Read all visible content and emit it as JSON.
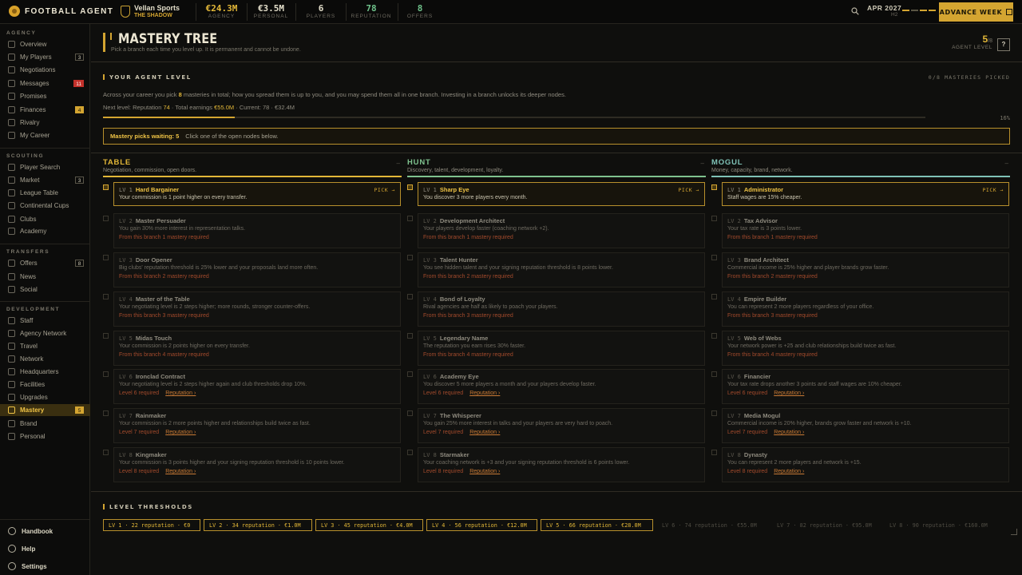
{
  "topbar": {
    "app_name": "FOOTBALL AGENT",
    "agency_name": "Vellan Sports",
    "agency_tag": "THE SHADOW",
    "stats": [
      {
        "value": "€24.3M",
        "label": "AGENCY",
        "color": "#e2b738"
      },
      {
        "value": "€3.5M",
        "label": "PERSONAL",
        "color": "#e2ddc9"
      },
      {
        "value": "6",
        "label": "PLAYERS",
        "color": "#e2ddc9"
      },
      {
        "value": "78",
        "label": "REPUTATION",
        "color": "#6fc18a"
      },
      {
        "value": "8",
        "label": "OFFERS",
        "color": "#6fc18a"
      }
    ],
    "date": "APR 2027",
    "half": "H2",
    "advance_label": "ADVANCE WEEK"
  },
  "sidebar": {
    "sections": [
      {
        "label": "AGENCY"
      },
      {
        "label": "SCOUTING"
      },
      {
        "label": "TRANSFERS"
      },
      {
        "label": "DEVELOPMENT"
      }
    ],
    "items": [
      {
        "label": "Overview"
      },
      {
        "label": "My Players",
        "badge": "3"
      },
      {
        "label": "Negotiations"
      },
      {
        "label": "Messages",
        "badge": "11"
      },
      {
        "label": "Promises"
      },
      {
        "label": "Finances",
        "badge": "4"
      },
      {
        "label": "Rivalry"
      },
      {
        "label": "My Career"
      },
      {
        "label": "Player Search"
      },
      {
        "label": "Market",
        "badge": "3"
      },
      {
        "label": "League Table"
      },
      {
        "label": "Continental Cups"
      },
      {
        "label": "Clubs"
      },
      {
        "label": "Academy"
      },
      {
        "label": "Offers",
        "badge": "8"
      },
      {
        "label": "News"
      },
      {
        "label": "Social"
      },
      {
        "label": "Staff"
      },
      {
        "label": "Agency Network"
      },
      {
        "label": "Travel"
      },
      {
        "label": "Network"
      },
      {
        "label": "Headquarters"
      },
      {
        "label": "Facilities"
      },
      {
        "label": "Upgrades"
      },
      {
        "label": "Mastery",
        "badge": "5"
      },
      {
        "label": "Brand"
      },
      {
        "label": "Personal"
      }
    ],
    "bottom": [
      {
        "label": "Handbook"
      },
      {
        "label": "Help"
      },
      {
        "label": "Settings"
      }
    ]
  },
  "page": {
    "title": "MASTERY TREE",
    "subtitle": "Pick a branch each time you level up. It is permanent and cannot be undone.",
    "agent_level": "5",
    "agent_level_total": "/8",
    "agent_level_label": "AGENT LEVEL",
    "help_label": "?"
  },
  "agent": {
    "heading": "YOUR AGENT LEVEL",
    "picked": "0/8 MASTERIES PICKED",
    "intro_a": "Across your career you pick ",
    "intro_num": "8",
    "intro_b": " masteries in total; how you spread them is up to you, and you may spend them all in one branch. Investing in a branch unlocks its deeper nodes.",
    "next_a": "Next level: Reputation ",
    "next_rep": "74",
    "next_b": " · Total earnings ",
    "next_earn": "€55.0M",
    "next_c": " · Current: 78 · €32.4M",
    "progress": 0.16,
    "progress_label": "16%",
    "waiting_label": "Mastery picks waiting: 5",
    "waiting_hint": "Click one of the open nodes below."
  },
  "branches": [
    {
      "name": "TABLE",
      "desc": "Negotiation, commission, open doors.",
      "color": "#e2b738",
      "nodes": [
        {
          "lv": "LV 1",
          "name": "Hard Bargainer",
          "desc": "Your commission is 1 point higher on every transfer.",
          "req": "",
          "link": "",
          "open": true,
          "pick": "PICK →"
        },
        {
          "lv": "LV 2",
          "name": "Master Persuader",
          "desc": "You gain 30% more interest in representation talks.",
          "req": "From this branch 1 mastery required",
          "link": ""
        },
        {
          "lv": "LV 3",
          "name": "Door Opener",
          "desc": "Big clubs' reputation threshold is 25% lower and your proposals land more often.",
          "req": "From this branch 2 mastery required",
          "link": ""
        },
        {
          "lv": "LV 4",
          "name": "Master of the Table",
          "desc": "Your negotiating level is 2 steps higher; more rounds, stronger counter-offers.",
          "req": "From this branch 3 mastery required",
          "link": ""
        },
        {
          "lv": "LV 5",
          "name": "Midas Touch",
          "desc": "Your commission is 2 points higher on every transfer.",
          "req": "From this branch 4 mastery required",
          "link": ""
        },
        {
          "lv": "LV 6",
          "name": "Ironclad Contract",
          "desc": "Your negotiating level is 2 steps higher again and club thresholds drop 10%.",
          "req": "Level 6 required",
          "link": "Reputation ›"
        },
        {
          "lv": "LV 7",
          "name": "Rainmaker",
          "desc": "Your commission is 2 more points higher and relationships build twice as fast.",
          "req": "Level 7 required",
          "link": "Reputation ›"
        },
        {
          "lv": "LV 8",
          "name": "Kingmaker",
          "desc": "Your commission is 3 points higher and your signing reputation threshold is 10 points lower.",
          "req": "Level 8 required",
          "link": "Reputation ›"
        }
      ]
    },
    {
      "name": "HUNT",
      "desc": "Discovery, talent, development, loyalty.",
      "color": "#7fc28e",
      "nodes": [
        {
          "lv": "LV 1",
          "name": "Sharp Eye",
          "desc": "You discover 3 more players every month.",
          "req": "",
          "link": "",
          "open": true,
          "pick": "PICK →"
        },
        {
          "lv": "LV 2",
          "name": "Development Architect",
          "desc": "Your players develop faster (coaching network +2).",
          "req": "From this branch 1 mastery required",
          "link": ""
        },
        {
          "lv": "LV 3",
          "name": "Talent Hunter",
          "desc": "You see hidden talent and your signing reputation threshold is 8 points lower.",
          "req": "From this branch 2 mastery required",
          "link": ""
        },
        {
          "lv": "LV 4",
          "name": "Bond of Loyalty",
          "desc": "Rival agencies are half as likely to poach your players.",
          "req": "From this branch 3 mastery required",
          "link": ""
        },
        {
          "lv": "LV 5",
          "name": "Legendary Name",
          "desc": "The reputation you earn rises 30% faster.",
          "req": "From this branch 4 mastery required",
          "link": ""
        },
        {
          "lv": "LV 6",
          "name": "Academy Eye",
          "desc": "You discover 5 more players a month and your players develop faster.",
          "req": "Level 6 required",
          "link": "Reputation ›"
        },
        {
          "lv": "LV 7",
          "name": "The Whisperer",
          "desc": "You gain 25% more interest in talks and your players are very hard to poach.",
          "req": "Level 7 required",
          "link": "Reputation ›"
        },
        {
          "lv": "LV 8",
          "name": "Starmaker",
          "desc": "Your coaching network is +3 and your signing reputation threshold is 6 points lower.",
          "req": "Level 8 required",
          "link": "Reputation ›"
        }
      ]
    },
    {
      "name": "MOGUL",
      "desc": "Money, capacity, brand, network.",
      "color": "#7fc2b6",
      "nodes": [
        {
          "lv": "LV 1",
          "name": "Administrator",
          "desc": "Staff wages are 15% cheaper.",
          "req": "",
          "link": "",
          "open": true,
          "pick": "PICK →"
        },
        {
          "lv": "LV 2",
          "name": "Tax Advisor",
          "desc": "Your tax rate is 3 points lower.",
          "req": "From this branch 1 mastery required",
          "link": ""
        },
        {
          "lv": "LV 3",
          "name": "Brand Architect",
          "desc": "Commercial income is 25% higher and player brands grow faster.",
          "req": "From this branch 2 mastery required",
          "link": ""
        },
        {
          "lv": "LV 4",
          "name": "Empire Builder",
          "desc": "You can represent 2 more players regardless of your office.",
          "req": "From this branch 3 mastery required",
          "link": ""
        },
        {
          "lv": "LV 5",
          "name": "Web of Webs",
          "desc": "Your network power is +25 and club relationships build twice as fast.",
          "req": "From this branch 4 mastery required",
          "link": ""
        },
        {
          "lv": "LV 6",
          "name": "Financier",
          "desc": "Your tax rate drops another 3 points and staff wages are 10% cheaper.",
          "req": "Level 6 required",
          "link": "Reputation ›"
        },
        {
          "lv": "LV 7",
          "name": "Media Mogul",
          "desc": "Commercial income is 20% higher, brands grow faster and network is +10.",
          "req": "Level 7 required",
          "link": "Reputation ›"
        },
        {
          "lv": "LV 8",
          "name": "Dynasty",
          "desc": "You can represent 2 more players and network is +15.",
          "req": "Level 8 required",
          "link": "Reputation ›"
        }
      ]
    }
  ],
  "thresholds": {
    "heading": "LEVEL THRESHOLDS",
    "items": [
      {
        "text": "LV 1 · 22 reputation · €0",
        "on": true
      },
      {
        "text": "LV 2 · 34 reputation · €1.0M",
        "on": true
      },
      {
        "text": "LV 3 · 45 reputation · €4.0M",
        "on": true
      },
      {
        "text": "LV 4 · 56 reputation · €12.0M",
        "on": true
      },
      {
        "text": "LV 5 · 66 reputation · €28.0M",
        "on": true
      },
      {
        "text": "LV 6 · 74 reputation · €55.0M",
        "on": false
      },
      {
        "text": "LV 7 · 82 reputation · €95.0M",
        "on": false
      },
      {
        "text": "LV 8 · 90 reputation · €160.0M",
        "on": false
      }
    ]
  }
}
